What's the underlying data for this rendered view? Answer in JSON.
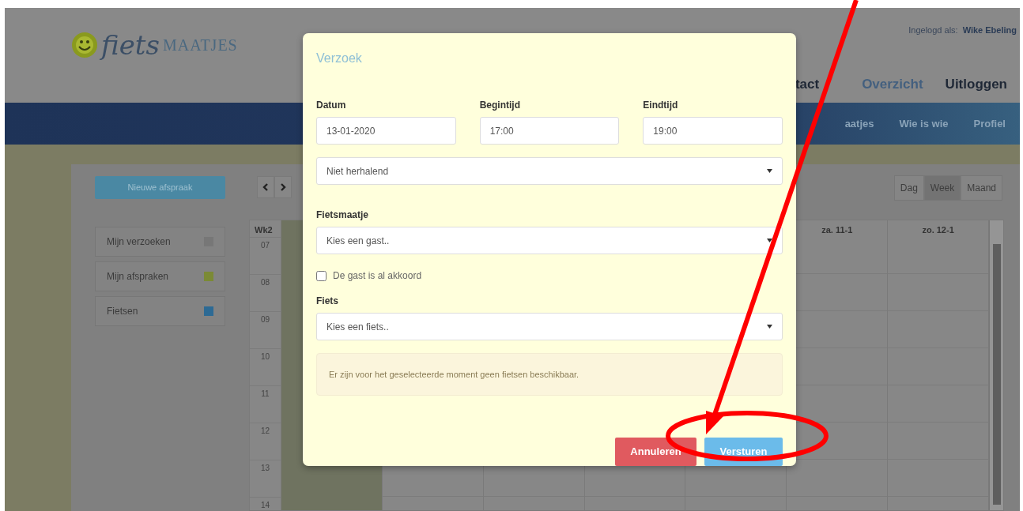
{
  "header": {
    "logo": {
      "word_1": "fiets",
      "word_2": "MAATJES"
    },
    "login_label": "Ingelogd als:",
    "user_name": "Wike Ebeling",
    "top_nav": [
      {
        "label": "tact",
        "selected": false
      },
      {
        "label": "Overzicht",
        "selected": true
      },
      {
        "label": "Uitloggen",
        "selected": false
      }
    ]
  },
  "main_nav": [
    {
      "label": "aatjes"
    },
    {
      "label": "Wie is wie"
    },
    {
      "label": "Profiel"
    }
  ],
  "calendar": {
    "new_button": "Nieuwe afspraak",
    "legend": [
      {
        "label": "Mijn verzoeken",
        "color": "#777777"
      },
      {
        "label": "Mijn afspraken",
        "color": "#7b8a35"
      },
      {
        "label": "Fietsen",
        "color": "#2d6a94"
      }
    ],
    "views": [
      {
        "label": "Dag",
        "selected": false
      },
      {
        "label": "Week",
        "selected": true
      },
      {
        "label": "Maand",
        "selected": false
      }
    ],
    "week_label": "Wk2",
    "columns": [
      {
        "today": true
      },
      {
        "today": false
      },
      {
        "today": false
      },
      {
        "today": false
      },
      {
        "today": false
      },
      {
        "label": "za. 11-1",
        "today": false
      },
      {
        "label": "zo. 12-1",
        "today": false
      }
    ],
    "hours": [
      "07",
      "08",
      "09",
      "10",
      "11",
      "12",
      "13",
      "14"
    ]
  },
  "modal": {
    "title": "Verzoek",
    "time_fields": [
      {
        "label": "Datum",
        "value": "13-01-2020"
      },
      {
        "label": "Begintijd",
        "value": "17:00"
      },
      {
        "label": "Eindtijd",
        "value": "19:00"
      }
    ],
    "repeat": {
      "value": "Niet herhalend"
    },
    "guest": {
      "label": "Fietsmaatje",
      "value": "Kies een gast.."
    },
    "agreed": {
      "label": "De gast is al akkoord",
      "checked": false
    },
    "bike": {
      "label": "Fiets",
      "value": "Kies een fiets.."
    },
    "notice": "Er zijn voor het geselecteerde moment geen fietsen beschikbaar.",
    "buttons": [
      {
        "label": "Annuleren",
        "kind": "cancel"
      },
      {
        "label": "Versturen",
        "kind": "submit"
      }
    ]
  }
}
